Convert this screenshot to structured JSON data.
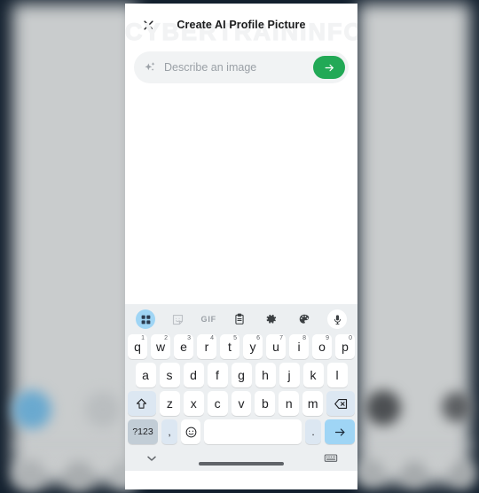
{
  "backdrop": {
    "name": "blurred-background"
  },
  "header": {
    "close_icon": "close-icon",
    "title": "Create AI Profile Picture",
    "watermark": "CYBERTRAININFO"
  },
  "prompt": {
    "sparkle_icon": "sparkle-icon",
    "value": "",
    "placeholder": "Describe an image",
    "send_icon": "arrow-right-icon",
    "send_color": "#22a956"
  },
  "keyboard": {
    "toolbar": [
      {
        "name": "apps-grid-icon",
        "label": "",
        "active": true
      },
      {
        "name": "sticker-icon",
        "label": ""
      },
      {
        "name": "gif-icon",
        "label": "GIF"
      },
      {
        "name": "clipboard-icon",
        "label": ""
      },
      {
        "name": "gear-icon",
        "label": ""
      },
      {
        "name": "palette-icon",
        "label": ""
      },
      {
        "name": "microphone-icon",
        "label": ""
      }
    ],
    "row1": [
      {
        "key": "q",
        "sup": "1"
      },
      {
        "key": "w",
        "sup": "2"
      },
      {
        "key": "e",
        "sup": "3"
      },
      {
        "key": "r",
        "sup": "4"
      },
      {
        "key": "t",
        "sup": "5"
      },
      {
        "key": "y",
        "sup": "6"
      },
      {
        "key": "u",
        "sup": "7"
      },
      {
        "key": "i",
        "sup": "8"
      },
      {
        "key": "o",
        "sup": "9"
      },
      {
        "key": "p",
        "sup": "0"
      }
    ],
    "row2": [
      {
        "key": "a"
      },
      {
        "key": "s"
      },
      {
        "key": "d"
      },
      {
        "key": "f"
      },
      {
        "key": "g"
      },
      {
        "key": "h"
      },
      {
        "key": "j"
      },
      {
        "key": "k"
      },
      {
        "key": "l"
      }
    ],
    "row3": [
      {
        "key": "z"
      },
      {
        "key": "x"
      },
      {
        "key": "c"
      },
      {
        "key": "v"
      },
      {
        "key": "b"
      },
      {
        "key": "n"
      },
      {
        "key": "m"
      }
    ],
    "shift_icon": "shift-icon",
    "backspace_icon": "backspace-icon",
    "symbols_label": "?123",
    "comma_label": ",",
    "emoji_icon": "emoji-icon",
    "space_label": "",
    "period_label": ".",
    "enter_icon": "enter-arrow-icon",
    "accent_key_color": "#9fd5f5",
    "fn_key_color": "#dce7f2"
  },
  "navbar": {
    "back_icon": "chevron-down-icon",
    "handle": "home-handle",
    "keyboard_icon": "keyboard-switch-icon"
  }
}
